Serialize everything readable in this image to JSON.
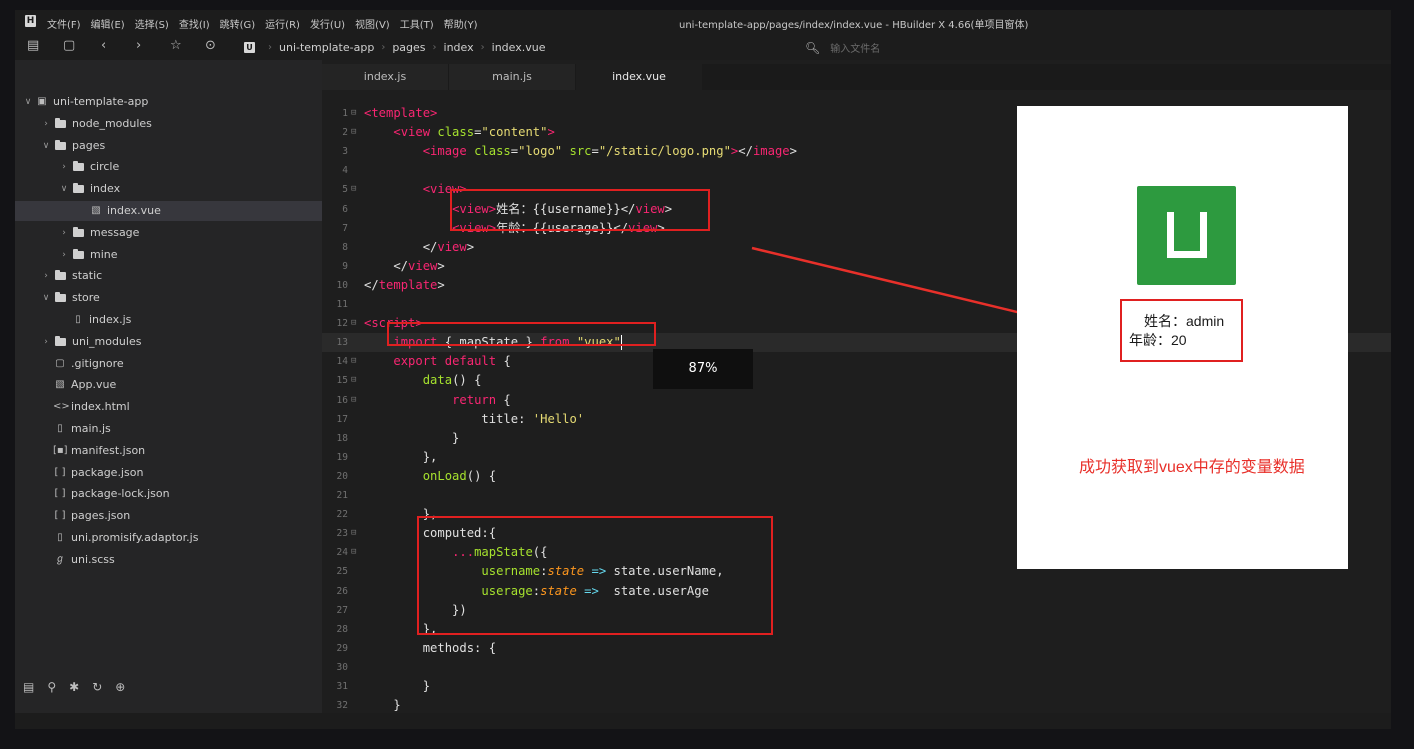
{
  "app": {
    "window_title": "uni-template-app/pages/index/index.vue - HBuilder X 4.66(单项目窗体)",
    "logo_letter": "H"
  },
  "menu": [
    "文件(F)",
    "编辑(E)",
    "选择(S)",
    "查找(I)",
    "跳转(G)",
    "运行(R)",
    "发行(U)",
    "视图(V)",
    "工具(T)",
    "帮助(Y)"
  ],
  "toolbar": {
    "breadcrumb": [
      "uni-template-app",
      "pages",
      "index",
      "index.vue"
    ],
    "project_letter": "U",
    "file_search_placeholder": "输入文件名"
  },
  "sidebar": {
    "tree": [
      {
        "label": "uni-template-app",
        "icon": "project-icon",
        "twisty": "open"
      },
      {
        "label": "node_modules",
        "icon": "folder-icon",
        "twisty": "closed"
      },
      {
        "label": "pages",
        "icon": "folder-open-icon",
        "twisty": "open"
      },
      {
        "label": "circle",
        "icon": "folder-icon",
        "twisty": "closed"
      },
      {
        "label": "index",
        "icon": "folder-open-icon",
        "twisty": "open"
      },
      {
        "label": "index.vue",
        "icon": "vue-file-icon",
        "twisty": "",
        "selected": true
      },
      {
        "label": "message",
        "icon": "folder-icon",
        "twisty": "closed"
      },
      {
        "label": "mine",
        "icon": "folder-icon",
        "twisty": "closed"
      },
      {
        "label": "static",
        "icon": "folder-icon",
        "twisty": "closed"
      },
      {
        "label": "store",
        "icon": "folder-open-icon",
        "twisty": "open"
      },
      {
        "label": "index.js",
        "icon": "js-file-icon",
        "twisty": ""
      },
      {
        "label": "uni_modules",
        "icon": "folder-icon",
        "twisty": "closed"
      },
      {
        "label": ".gitignore",
        "icon": "file-icon",
        "twisty": ""
      },
      {
        "label": "App.vue",
        "icon": "vue-file-icon",
        "twisty": ""
      },
      {
        "label": "index.html",
        "icon": "html-file-icon",
        "twisty": ""
      },
      {
        "label": "main.js",
        "icon": "js-file-icon",
        "twisty": ""
      },
      {
        "label": "manifest.json",
        "icon": "manifest-icon",
        "twisty": ""
      },
      {
        "label": "package.json",
        "icon": "json-file-icon",
        "twisty": ""
      },
      {
        "label": "package-lock.json",
        "icon": "json-file-icon",
        "twisty": ""
      },
      {
        "label": "pages.json",
        "icon": "json-file-icon",
        "twisty": ""
      },
      {
        "label": "uni.promisify.adaptor.js",
        "icon": "js-file-icon",
        "twisty": ""
      },
      {
        "label": "uni.scss",
        "icon": "scss-file-icon",
        "twisty": ""
      }
    ]
  },
  "tabs": [
    {
      "label": "index.js",
      "active": false
    },
    {
      "label": "main.js",
      "active": false
    },
    {
      "label": "index.vue",
      "active": true
    }
  ],
  "editor": {
    "current_line": 13,
    "lines": [
      {
        "n": "1",
        "fold": "⊟",
        "segs": [
          [
            "tg",
            "<template"
          ],
          [
            "tg",
            ">"
          ]
        ]
      },
      {
        "n": "2",
        "fold": "⊟",
        "segs": [
          [
            "",
            "    "
          ],
          [
            "tg",
            "<view"
          ],
          [
            "at",
            " class"
          ],
          [
            "",
            "="
          ],
          [
            "st",
            "\"content\""
          ],
          [
            "tg",
            ">"
          ]
        ]
      },
      {
        "n": "3",
        "fold": "",
        "segs": [
          [
            "",
            "        "
          ],
          [
            "tg",
            "<image"
          ],
          [
            "at",
            " class"
          ],
          [
            "",
            "="
          ],
          [
            "st",
            "\"logo\""
          ],
          [
            "at",
            " src"
          ],
          [
            "",
            "="
          ],
          [
            "st",
            "\"/static/logo.png\""
          ],
          [
            "tg",
            ">"
          ],
          [
            "",
            "</"
          ],
          [
            "tg",
            "image"
          ],
          [
            "",
            ">"
          ]
        ]
      },
      {
        "n": "4",
        "fold": "",
        "segs": []
      },
      {
        "n": "5",
        "fold": "⊟",
        "segs": [
          [
            "",
            "        "
          ],
          [
            "tg",
            "<view"
          ],
          [
            "tg",
            ">"
          ]
        ]
      },
      {
        "n": "6",
        "fold": "",
        "segs": [
          [
            "",
            "            "
          ],
          [
            "tg",
            "<view"
          ],
          [
            "tg",
            ">"
          ],
          [
            "",
            "姓名：{{username}}</"
          ],
          [
            "tg",
            "view"
          ],
          [
            "",
            ">"
          ]
        ]
      },
      {
        "n": "7",
        "fold": "",
        "segs": [
          [
            "",
            "            "
          ],
          [
            "tg",
            "<view"
          ],
          [
            "tg",
            ">"
          ],
          [
            "",
            "年龄：{{userage}}</"
          ],
          [
            "tg",
            "view"
          ],
          [
            "",
            ">"
          ]
        ]
      },
      {
        "n": "8",
        "fold": "",
        "segs": [
          [
            "",
            "        </"
          ],
          [
            "tg",
            "view"
          ],
          [
            "",
            ">"
          ]
        ]
      },
      {
        "n": "9",
        "fold": "",
        "segs": [
          [
            "",
            "    </"
          ],
          [
            "tg",
            "view"
          ],
          [
            "",
            ">"
          ]
        ]
      },
      {
        "n": "10",
        "fold": "",
        "segs": [
          [
            "",
            "</"
          ],
          [
            "tg",
            "template"
          ],
          [
            "",
            ">"
          ]
        ]
      },
      {
        "n": "11",
        "fold": "",
        "segs": []
      },
      {
        "n": "12",
        "fold": "⊟",
        "segs": [
          [
            "tg",
            "<script"
          ],
          [
            "tg",
            ">"
          ]
        ]
      },
      {
        "n": "13",
        "fold": "",
        "segs": [
          [
            "",
            "    "
          ],
          [
            "kw",
            "import"
          ],
          [
            "",
            " { mapState } "
          ],
          [
            "kw",
            "from"
          ],
          [
            "",
            " "
          ],
          [
            "st",
            "\"vuex\""
          ]
        ]
      },
      {
        "n": "14",
        "fold": "⊟",
        "segs": [
          [
            "",
            "    "
          ],
          [
            "kw",
            "export"
          ],
          [
            "",
            " "
          ],
          [
            "kw",
            "default"
          ],
          [
            "",
            " {"
          ]
        ]
      },
      {
        "n": "15",
        "fold": "⊟",
        "segs": [
          [
            "",
            "        "
          ],
          [
            "at",
            "data"
          ],
          [
            "",
            "() {"
          ]
        ]
      },
      {
        "n": "16",
        "fold": "⊟",
        "segs": [
          [
            "",
            "            "
          ],
          [
            "kw",
            "return"
          ],
          [
            "",
            " {"
          ]
        ]
      },
      {
        "n": "17",
        "fold": "",
        "segs": [
          [
            "",
            "                title: "
          ],
          [
            "st",
            "'Hello'"
          ]
        ]
      },
      {
        "n": "18",
        "fold": "",
        "segs": [
          [
            "",
            "            }"
          ]
        ]
      },
      {
        "n": "19",
        "fold": "",
        "segs": [
          [
            "",
            "        },"
          ]
        ]
      },
      {
        "n": "20",
        "fold": "",
        "segs": [
          [
            "",
            "        "
          ],
          [
            "at",
            "onLoad"
          ],
          [
            "",
            "() {"
          ]
        ]
      },
      {
        "n": "21",
        "fold": "",
        "segs": []
      },
      {
        "n": "22",
        "fold": "",
        "segs": [
          [
            "",
            "        },"
          ]
        ]
      },
      {
        "n": "23",
        "fold": "⊟",
        "segs": [
          [
            "",
            "        computed:{"
          ]
        ]
      },
      {
        "n": "24",
        "fold": "⊟",
        "segs": [
          [
            "",
            "            "
          ],
          [
            "kw",
            "..."
          ],
          [
            "at",
            "mapState"
          ],
          [
            "",
            "({"
          ]
        ]
      },
      {
        "n": "25",
        "fold": "",
        "segs": [
          [
            "",
            "                "
          ],
          [
            "at",
            "username"
          ],
          [
            "",
            ":"
          ],
          [
            "it",
            "state"
          ],
          [
            "",
            " "
          ],
          [
            "op",
            "=>"
          ],
          [
            "",
            " state.userName,"
          ]
        ]
      },
      {
        "n": "26",
        "fold": "",
        "segs": [
          [
            "",
            "                "
          ],
          [
            "at",
            "userage"
          ],
          [
            "",
            ":"
          ],
          [
            "it",
            "state"
          ],
          [
            "",
            " "
          ],
          [
            "op",
            "=>"
          ],
          [
            "",
            "  state.userAge"
          ]
        ]
      },
      {
        "n": "27",
        "fold": "",
        "segs": [
          [
            "",
            "            })"
          ]
        ]
      },
      {
        "n": "28",
        "fold": "",
        "segs": [
          [
            "",
            "        },"
          ]
        ]
      },
      {
        "n": "29",
        "fold": "",
        "segs": [
          [
            "",
            "        methods: {"
          ]
        ]
      },
      {
        "n": "30",
        "fold": "",
        "segs": []
      },
      {
        "n": "31",
        "fold": "",
        "segs": [
          [
            "",
            "        }"
          ]
        ]
      },
      {
        "n": "32",
        "fold": "",
        "segs": [
          [
            "",
            "    }"
          ]
        ]
      }
    ],
    "zoom_label": "87%"
  },
  "preview": {
    "name_line": "姓名：admin",
    "age_line": "年龄：20"
  },
  "annotation": {
    "note": "成功获取到vuex中存的变量数据",
    "highlight_color": "#e02020"
  }
}
